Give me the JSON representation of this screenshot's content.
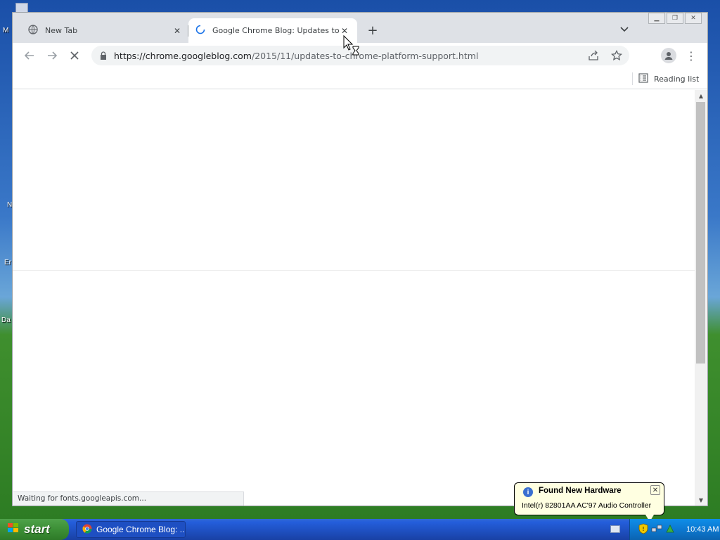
{
  "desktop": {
    "labels": [
      "M",
      "N",
      "Er",
      "Da"
    ]
  },
  "browser": {
    "tabs": [
      {
        "title": "New Tab",
        "state": "inactive",
        "icon": "globe-icon"
      },
      {
        "title": "Google Chrome Blog: Updates to Ch",
        "state": "active",
        "icon": "loading-spinner-icon"
      }
    ],
    "url": {
      "host": "https://chrome.googleblog.com",
      "path": "/2015/11/updates-to-chrome-platform-support.html"
    },
    "reading_list_label": "Reading list",
    "status_text": "Waiting for fonts.googleapis.com..."
  },
  "taskbar": {
    "start_label": "start",
    "task_label": "Google Chrome Blog: ...",
    "clock": "10:43 AM"
  },
  "notification": {
    "title": "Found New Hardware",
    "text": "Intel(r) 82801AA AC'97 Audio Controller"
  }
}
